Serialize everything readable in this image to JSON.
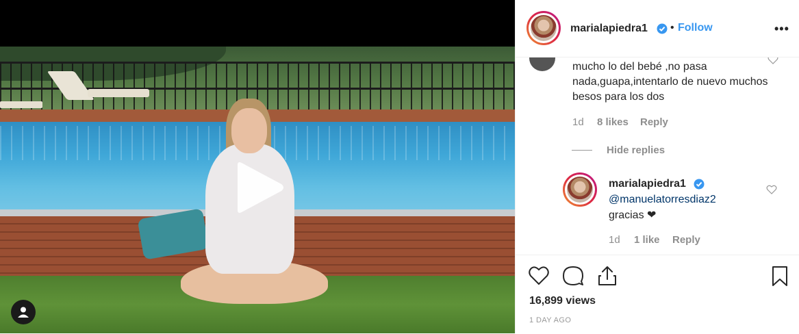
{
  "post": {
    "username": "marialapiedra1",
    "follow_label": "Follow",
    "separator": "•",
    "more_label": "•••",
    "verified": true
  },
  "comments": {
    "parent_text": "mucho lo del bebé ,no pasa nada,guapa,intentarlo de nuevo muchos besos para los dos",
    "parent_time": "1d",
    "parent_likes": "8 likes",
    "parent_reply": "Reply",
    "hide_replies": "Hide replies",
    "reply": {
      "username": "marialapiedra1",
      "mention": "@manuelatorresdiaz2",
      "text": "gracias",
      "emoji": "❤",
      "time": "1d",
      "likes": "1 like",
      "reply_label": "Reply"
    }
  },
  "stats": {
    "views": "16,899 views",
    "time_ago": "1 DAY AGO"
  },
  "icons": {
    "like": "heart-icon",
    "comment": "comment-icon",
    "share": "share-icon",
    "save": "bookmark-icon",
    "play": "play-icon",
    "tagged": "user-tag-icon"
  },
  "colors": {
    "follow": "#3897f0",
    "meta": "#8e8e8e",
    "text": "#262626"
  }
}
